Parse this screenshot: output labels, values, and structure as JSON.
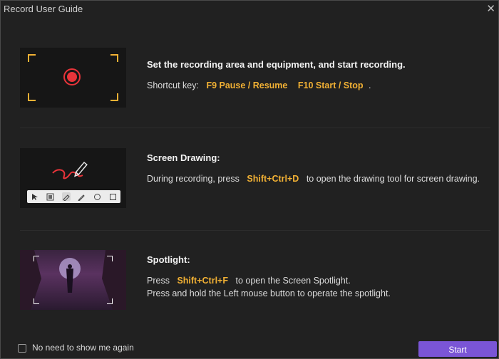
{
  "window": {
    "title": "Record User Guide",
    "close_icon": "close-icon"
  },
  "sections": [
    {
      "heading": "Set the recording area and equipment, and start recording.",
      "line_prefix": "Shortcut key:",
      "key1": "F9 Pause / Resume",
      "key2": "F10 Start / Stop",
      "line_suffix": "."
    },
    {
      "heading": "Screen Drawing:",
      "line_prefix": "During recording, press",
      "key1": "Shift+Ctrl+D",
      "line_suffix": "to open the drawing tool for screen drawing."
    },
    {
      "heading": "Spotlight:",
      "line_prefix": "Press",
      "key1": "Shift+Ctrl+F",
      "line_suffix": "to open the Screen Spotlight.",
      "line2": "Press and hold the Left mouse button to operate the spotlight."
    }
  ],
  "footer": {
    "checkbox_label": "No need to show me again",
    "checked": false,
    "start_label": "Start"
  },
  "colors": {
    "accent": "#7a55d6",
    "shortcut": "#f2b134",
    "record": "#e8343a",
    "background": "#212121"
  }
}
